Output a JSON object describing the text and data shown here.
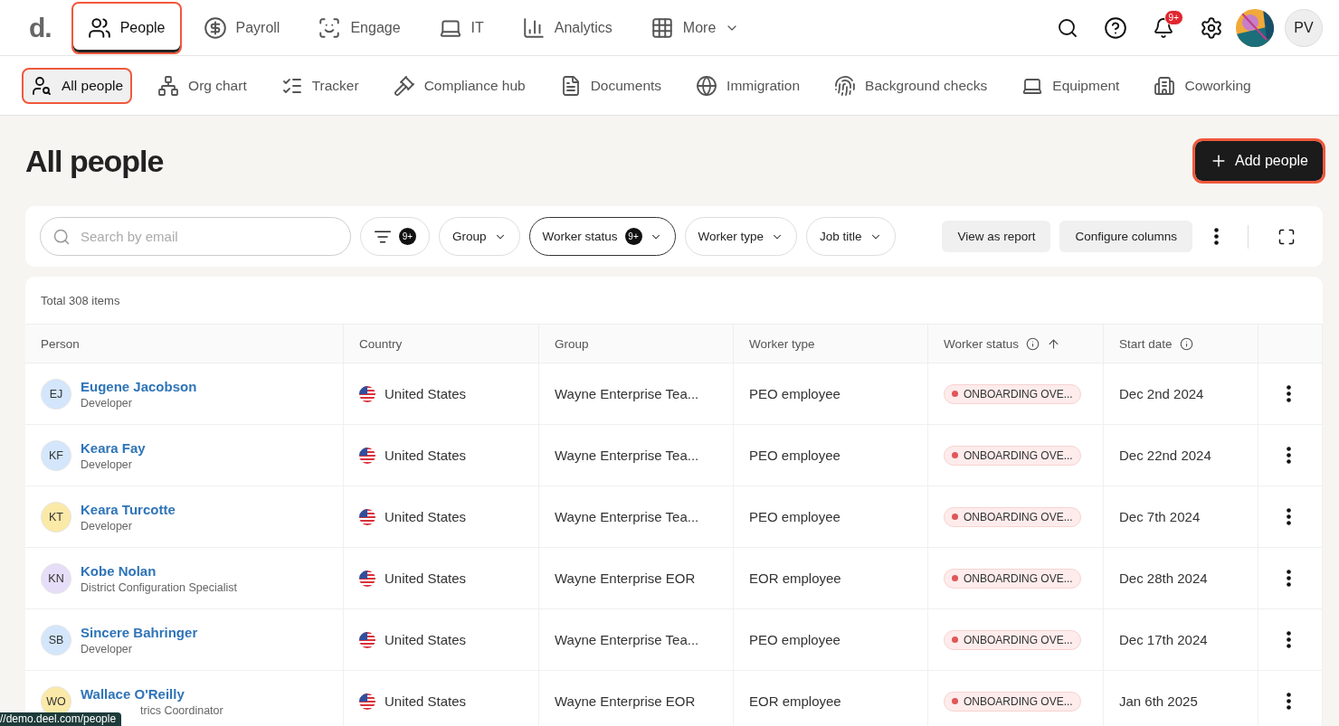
{
  "logo": "d.",
  "main_nav": [
    {
      "label": "People",
      "kind": "link",
      "selected": true,
      "highlighted": true
    },
    {
      "label": "Payroll",
      "kind": "link",
      "selected": false,
      "highlighted": false
    },
    {
      "label": "Engage",
      "kind": "link",
      "selected": false,
      "highlighted": false
    },
    {
      "label": "IT",
      "kind": "link",
      "selected": false,
      "highlighted": false
    },
    {
      "label": "Analytics",
      "kind": "link",
      "selected": false,
      "highlighted": false
    },
    {
      "label": "More",
      "kind": "menu",
      "selected": false,
      "highlighted": false
    }
  ],
  "header": {
    "notification_badge": "9+",
    "user_initials": "PV"
  },
  "sub_nav": [
    {
      "label": "All people",
      "selected": true,
      "highlighted": true
    },
    {
      "label": "Org chart",
      "selected": false,
      "highlighted": false
    },
    {
      "label": "Tracker",
      "selected": false,
      "highlighted": false
    },
    {
      "label": "Compliance hub",
      "selected": false,
      "highlighted": false
    },
    {
      "label": "Documents",
      "selected": false,
      "highlighted": false
    },
    {
      "label": "Immigration",
      "selected": false,
      "highlighted": false
    },
    {
      "label": "Background checks",
      "selected": false,
      "highlighted": false
    },
    {
      "label": "Equipment",
      "selected": false,
      "highlighted": false
    },
    {
      "label": "Coworking",
      "selected": false,
      "highlighted": false
    }
  ],
  "page_title": "All people",
  "add_button": {
    "label": "Add people",
    "highlighted": true
  },
  "toolbar": {
    "search_placeholder": "Search by email",
    "filter_badge": "9+",
    "dropdowns": [
      {
        "label": "Group",
        "active": false
      },
      {
        "label": "Worker status",
        "active": true,
        "badge": "9+"
      },
      {
        "label": "Worker type",
        "active": false
      },
      {
        "label": "Job title",
        "active": false
      }
    ],
    "buttons": [
      "View as report",
      "Configure columns"
    ]
  },
  "table": {
    "total": "Total 308 items",
    "columns": [
      {
        "label": "Person",
        "info": false,
        "sorted": false
      },
      {
        "label": "Country",
        "info": false,
        "sorted": false
      },
      {
        "label": "Group",
        "info": false,
        "sorted": false
      },
      {
        "label": "Worker type",
        "info": false,
        "sorted": false
      },
      {
        "label": "Worker status",
        "info": true,
        "sorted": true
      },
      {
        "label": "Start date",
        "info": true,
        "sorted": false
      }
    ],
    "rows": [
      {
        "initials": "EJ",
        "color": "#d3e6fb",
        "name": "Eugene Jacobson",
        "title": "Developer",
        "country": "United States",
        "group": "Wayne Enterprise Tea...",
        "worker_type": "PEO employee",
        "status": "ONBOARDING OVE...",
        "start_date": "Dec 2nd 2024"
      },
      {
        "initials": "KF",
        "color": "#d3e6fb",
        "name": "Keara Fay",
        "title": "Developer",
        "country": "United States",
        "group": "Wayne Enterprise Tea...",
        "worker_type": "PEO employee",
        "status": "ONBOARDING OVE...",
        "start_date": "Dec 22nd 2024"
      },
      {
        "initials": "KT",
        "color": "#fbe9a8",
        "name": "Keara Turcotte",
        "title": "Developer",
        "country": "United States",
        "group": "Wayne Enterprise Tea...",
        "worker_type": "PEO employee",
        "status": "ONBOARDING OVE...",
        "start_date": "Dec 7th 2024"
      },
      {
        "initials": "KN",
        "color": "#e6def8",
        "name": "Kobe Nolan",
        "title": "District Configuration Specialist",
        "country": "United States",
        "group": "Wayne Enterprise EOR",
        "worker_type": "EOR employee",
        "status": "ONBOARDING OVE...",
        "start_date": "Dec 28th 2024"
      },
      {
        "initials": "SB",
        "color": "#d3e6fb",
        "name": "Sincere Bahringer",
        "title": "Developer",
        "country": "United States",
        "group": "Wayne Enterprise Tea...",
        "worker_type": "PEO employee",
        "status": "ONBOARDING OVE...",
        "start_date": "Dec 17th 2024"
      },
      {
        "initials": "WO",
        "color": "#fbe9a8",
        "name": "Wallace O'Reilly",
        "title": "trics Coordinator",
        "title_covered": true,
        "country": "United States",
        "group": "Wayne Enterprise EOR",
        "worker_type": "EOR employee",
        "status": "ONBOARDING OVE...",
        "start_date": "Jan 6th 2025"
      }
    ]
  },
  "link_preview": "//demo.deel.com/people"
}
